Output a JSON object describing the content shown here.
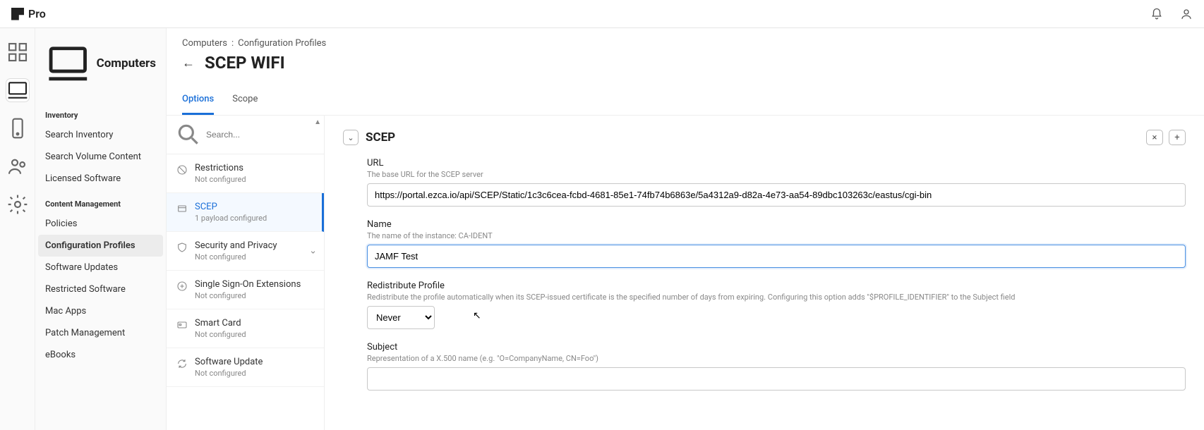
{
  "brand": "Pro",
  "topbar": {
    "bell": "bell-icon",
    "user": "user-icon"
  },
  "rail": [
    "dashboard",
    "computers",
    "devices",
    "users",
    "settings"
  ],
  "sidebar": {
    "title": "Computers",
    "sections": [
      {
        "heading": "Inventory",
        "items": [
          "Search Inventory",
          "Search Volume Content",
          "Licensed Software"
        ]
      },
      {
        "heading": "Content Management",
        "items": [
          "Policies",
          "Configuration Profiles",
          "Software Updates",
          "Restricted Software",
          "Mac Apps",
          "Patch Management",
          "eBooks"
        ],
        "active": "Configuration Profiles"
      }
    ]
  },
  "breadcrumb": {
    "root": "Computers",
    "sep": ":",
    "current": "Configuration Profiles"
  },
  "page_title": "SCEP WIFI",
  "tabs": {
    "items": [
      "Options",
      "Scope"
    ],
    "active": "Options"
  },
  "payload_search_placeholder": "Search...",
  "payloads": [
    {
      "name": "Restrictions",
      "sub": "Not configured",
      "icon": "restrict"
    },
    {
      "name": "SCEP",
      "sub": "1 payload configured",
      "icon": "scep",
      "active": true
    },
    {
      "name": "Security and Privacy",
      "sub": "Not configured",
      "icon": "shield",
      "expandable": true
    },
    {
      "name": "Single Sign-On Extensions",
      "sub": "Not configured",
      "icon": "sso"
    },
    {
      "name": "Smart Card",
      "sub": "Not configured",
      "icon": "card"
    },
    {
      "name": "Software Update",
      "sub": "Not configured",
      "icon": "update"
    }
  ],
  "panel": {
    "title": "SCEP",
    "fields": {
      "url": {
        "label": "URL",
        "help": "The base URL for the SCEP server",
        "value": "https://portal.ezca.io/api/SCEP/Static/1c3c6cea-fcbd-4681-85e1-74fb74b6863e/5a4312a9-d82a-4e73-aa54-89dbc103263c/eastus/cgi-bin"
      },
      "name": {
        "label": "Name",
        "help": "The name of the instance: CA-IDENT",
        "value": "JAMF Test"
      },
      "redistribute": {
        "label": "Redistribute Profile",
        "help": "Redistribute the profile automatically when its SCEP-issued certificate is the specified number of days from expiring. Configuring this option adds \"$PROFILE_IDENTIFIER\" to the Subject field",
        "value": "Never"
      },
      "subject": {
        "label": "Subject",
        "help": "Representation of a X.500 name (e.g. \"O=CompanyName, CN=Foo\")",
        "value": ""
      }
    }
  }
}
